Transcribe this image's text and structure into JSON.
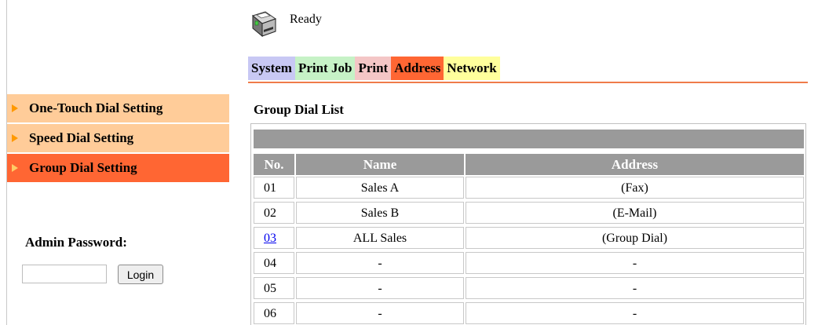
{
  "status": {
    "text": "Ready",
    "icon": "printer-ready-icon"
  },
  "tabs": [
    {
      "label": "System",
      "color": "#c8c8f4"
    },
    {
      "label": "Print Job",
      "color": "#c6f2c6"
    },
    {
      "label": "Print",
      "color": "#f4c6c6"
    },
    {
      "label": "Address",
      "color": "#ff6633",
      "active": true
    },
    {
      "label": "Network",
      "color": "#ffff9c"
    }
  ],
  "menu": [
    {
      "label": "One-Touch Dial Setting",
      "active": false
    },
    {
      "label": "Speed Dial Setting",
      "active": false
    },
    {
      "label": "Group Dial Setting",
      "active": true
    }
  ],
  "admin": {
    "label": "Admin Password:",
    "value": "",
    "login_label": "Login"
  },
  "group_list": {
    "title": "Group Dial List",
    "columns": {
      "no": "No.",
      "name": "Name",
      "address": "Address"
    },
    "rows": [
      {
        "no": "01",
        "name": "Sales A",
        "address": "(Fax)",
        "link": false
      },
      {
        "no": "02",
        "name": "Sales B",
        "address": "(E-Mail)",
        "link": false
      },
      {
        "no": "03",
        "name": "ALL Sales",
        "address": "(Group Dial)",
        "link": true
      },
      {
        "no": "04",
        "name": "-",
        "address": "-",
        "link": false
      },
      {
        "no": "05",
        "name": "-",
        "address": "-",
        "link": false
      },
      {
        "no": "06",
        "name": "-",
        "address": "-",
        "link": false
      }
    ]
  },
  "colors": {
    "accent": "#ff6633",
    "menu_inactive": "#ffcc99",
    "header_gray": "#9a9a9a",
    "link": "#0000ee"
  }
}
